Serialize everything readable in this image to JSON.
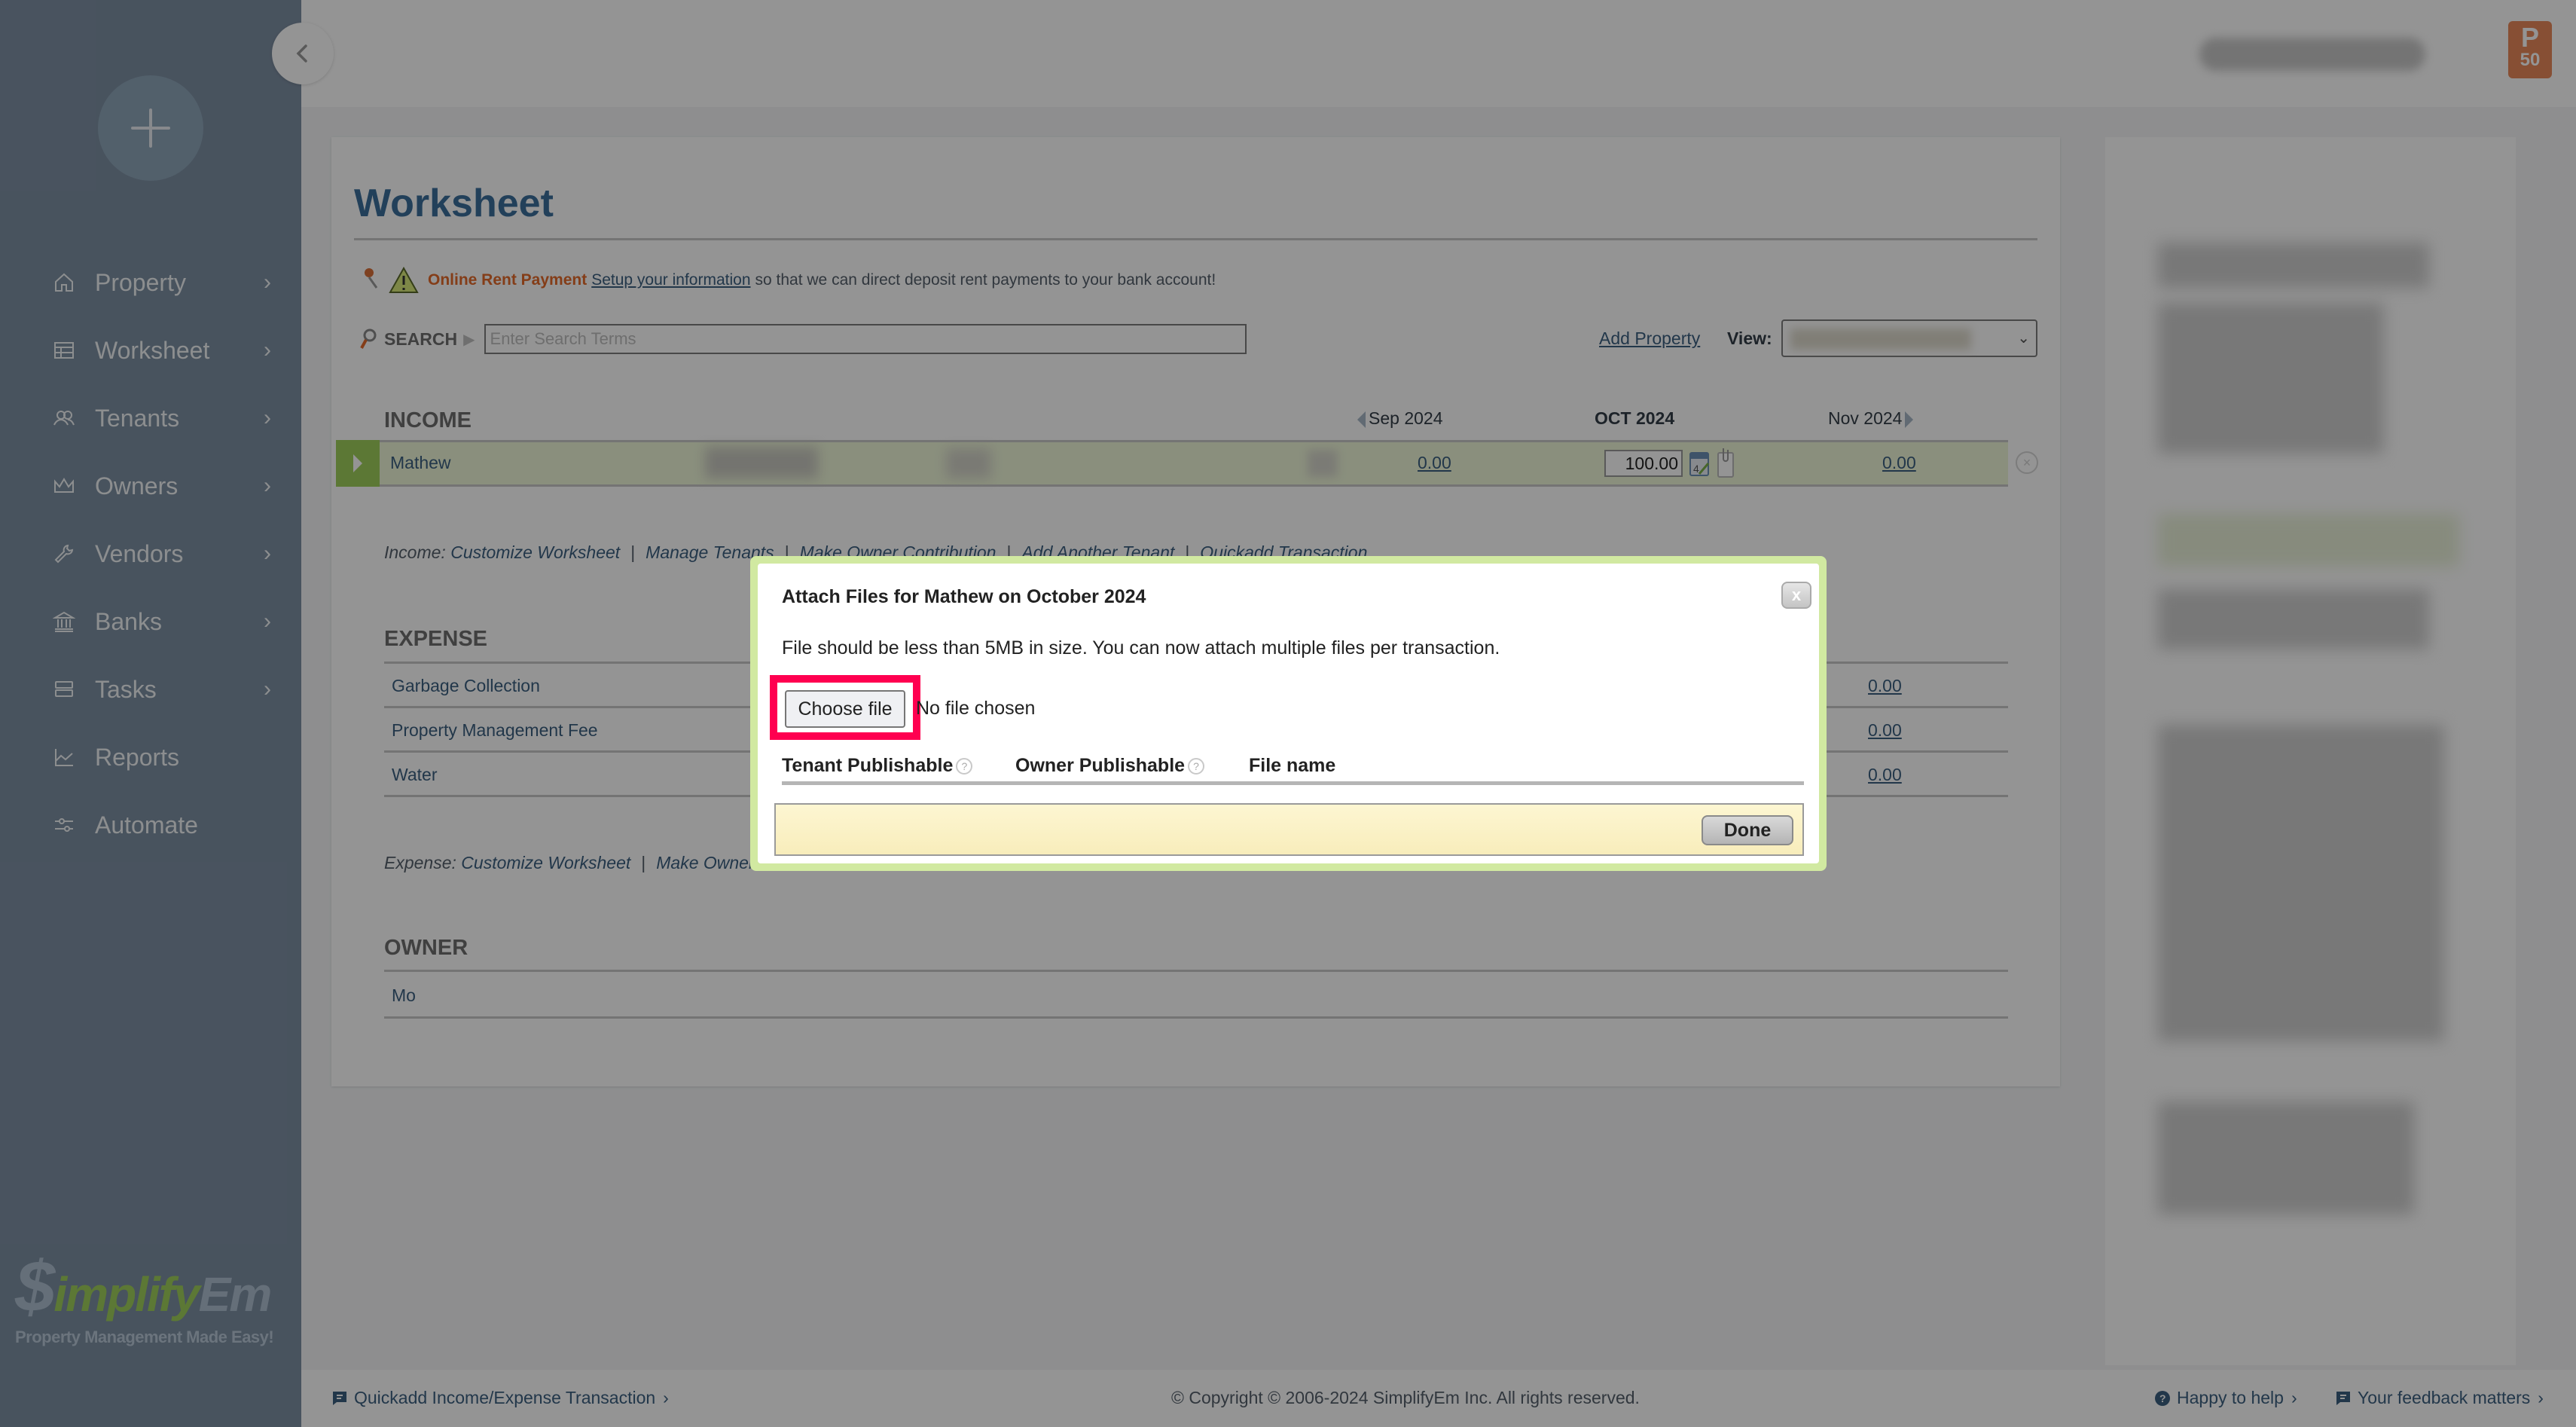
{
  "sidebar": {
    "items": [
      {
        "label": "Property",
        "icon": "home-icon",
        "has_chevron": true
      },
      {
        "label": "Worksheet",
        "icon": "table-icon",
        "has_chevron": true
      },
      {
        "label": "Tenants",
        "icon": "users-icon",
        "has_chevron": true
      },
      {
        "label": "Owners",
        "icon": "crown-icon",
        "has_chevron": true
      },
      {
        "label": "Vendors",
        "icon": "wrench-icon",
        "has_chevron": true
      },
      {
        "label": "Banks",
        "icon": "bank-icon",
        "has_chevron": true
      },
      {
        "label": "Tasks",
        "icon": "tasks-icon",
        "has_chevron": true
      },
      {
        "label": "Reports",
        "icon": "chart-line-icon",
        "has_chevron": false
      },
      {
        "label": "Automate",
        "icon": "sliders-icon",
        "has_chevron": false
      }
    ],
    "chevron": "›",
    "logo": {
      "dollar": "$",
      "green": "implify",
      "blue": "Em",
      "tagline": "Property Management Made Easy!"
    }
  },
  "header": {
    "plan_badge": {
      "letter": "P",
      "number": "50"
    }
  },
  "worksheet": {
    "title": "Worksheet",
    "notice": {
      "highlight": "Online Rent Payment",
      "link": "Setup your information",
      "text": "so that we can direct deposit rent payments to your bank account!"
    },
    "search": {
      "label": "SEARCH",
      "placeholder": "Enter Search Terms",
      "value": ""
    },
    "add_property": "Add Property",
    "view_label": "View:",
    "income": {
      "heading": "INCOME",
      "months": {
        "prev": "Sep 2024",
        "current": "OCT 2024",
        "next": "Nov 2024"
      },
      "rows": [
        {
          "name": "Mathew",
          "prev": "0.00",
          "current": "100.00",
          "next": "0.00",
          "note_count": "0"
        }
      ],
      "links_label": "Income:",
      "links": [
        "Customize Worksheet",
        "Manage Tenants",
        "Make Owner Contribution",
        "Add Another Tenant",
        "Quickadd Transaction"
      ]
    },
    "expense": {
      "heading": "EXPENSE",
      "rows": [
        {
          "name": "Garbage Collection",
          "next": "0.00"
        },
        {
          "name": "Property Management Fee",
          "next": "0.00"
        },
        {
          "name": "Water",
          "next": "0.00"
        }
      ],
      "links_label": "Expense:",
      "links": [
        "Customize Worksheet",
        "Make Owner Contribution"
      ]
    },
    "owner": {
      "heading": "OWNER",
      "rows": [
        {
          "name": "Mo"
        }
      ]
    }
  },
  "footer": {
    "quickadd": "Quickadd Income/Expense Transaction",
    "copyright": "© Copyright © 2006-2024 SimplifyEm Inc. All rights reserved.",
    "help": "Happy to help",
    "feedback": "Your feedback matters"
  },
  "modal": {
    "title": "Attach Files for Mathew on October 2024",
    "close": "x",
    "description": "File should be less than 5MB in size. You can now attach multiple files per transaction.",
    "choose_file": "Choose file",
    "no_file": "No file chosen",
    "columns": [
      "Tenant Publishable",
      "Owner Publishable",
      "File name"
    ],
    "help_glyph": "?",
    "done": "Done"
  },
  "colors": {
    "sidebar_bg": "#7d8fa3",
    "accent_green": "#9fcf5c",
    "modal_border": "#d1e9a1",
    "highlight": "#ff0050",
    "link": "#3b5f80",
    "warning_orange": "#e36a2a"
  }
}
